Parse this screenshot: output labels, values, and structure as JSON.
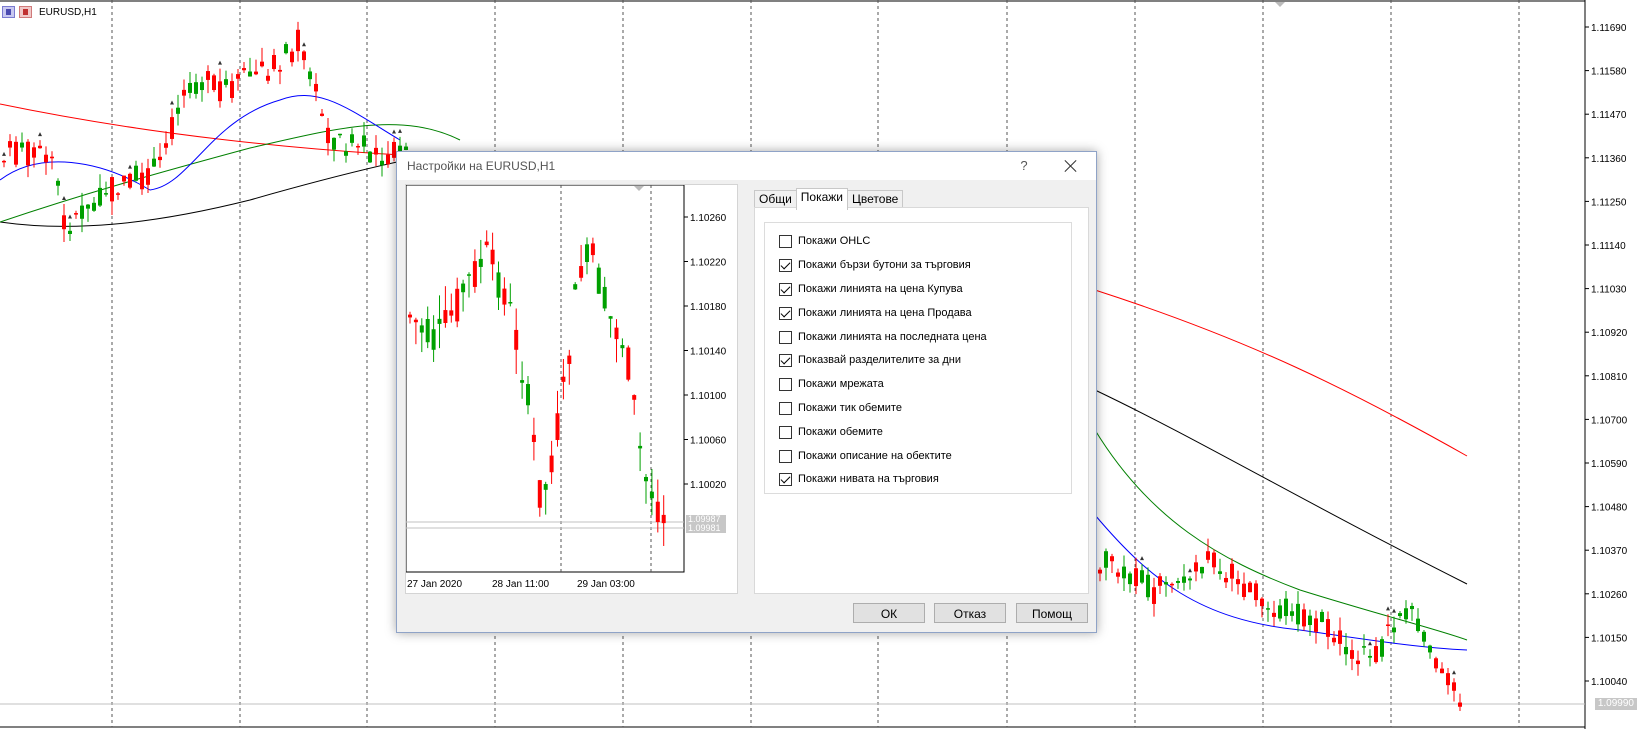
{
  "chart": {
    "symbol": "EURUSD,H1",
    "price_labels": [
      "1.11690",
      "1.11580",
      "1.11470",
      "1.11360",
      "1.11250",
      "1.11140",
      "1.11030",
      "1.10920",
      "1.10810",
      "1.10700",
      "1.10590",
      "1.10480",
      "1.10370",
      "1.10260",
      "1.10150",
      "1.10040"
    ],
    "current_price": "1.09990",
    "colors": {
      "bull": "#00a000",
      "bear": "#ff0000",
      "ma_fast": "#0000ff",
      "ma_mid": "#008000",
      "ma_slow_red": "#ff0000",
      "ma_black": "#000000"
    }
  },
  "dialog": {
    "title": "Настройки на EURUSD,H1",
    "help": "?",
    "tabs": [
      {
        "label": "Общи",
        "active": false
      },
      {
        "label": "Покажи",
        "active": true
      },
      {
        "label": "Цветове",
        "active": false
      }
    ],
    "options": [
      {
        "label": "Покажи OHLC",
        "checked": false
      },
      {
        "label": "Покажи бързи бутони за търговия",
        "checked": true
      },
      {
        "label": "Покажи линията на цена Купува",
        "checked": true
      },
      {
        "label": "Покажи линията на цена Продава",
        "checked": true
      },
      {
        "label": "Покажи линията на последната цена",
        "checked": false
      },
      {
        "label": "Показвай разделителите за дни",
        "checked": true
      },
      {
        "label": "Покажи мрежата",
        "checked": false
      },
      {
        "label": "Покажи тик обемите",
        "checked": false
      },
      {
        "label": "Покажи обемите",
        "checked": false
      },
      {
        "label": "Покажи описание на обектите",
        "checked": false
      },
      {
        "label": "Покажи нивата на търговия",
        "checked": true
      }
    ],
    "buttons": {
      "ok": "ОК",
      "cancel": "Отказ",
      "help": "Помощ"
    },
    "preview": {
      "price_labels": [
        "1.10260",
        "1.10220",
        "1.10180",
        "1.10140",
        "1.10100",
        "1.10060",
        "1.10020"
      ],
      "ask_label": "1.09987",
      "bid_label": "1.09981",
      "time_labels": [
        "27 Jan 2020",
        "28 Jan 11:00",
        "29 Jan 03:00"
      ]
    }
  }
}
